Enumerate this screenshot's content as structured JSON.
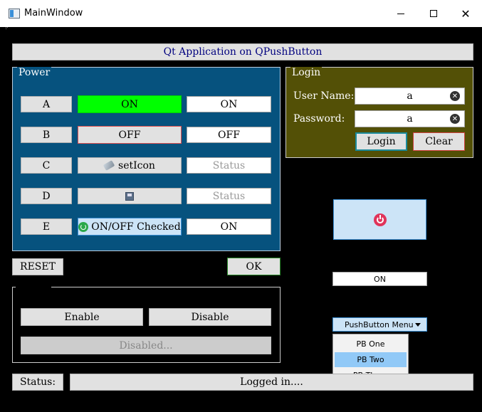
{
  "window": {
    "title": "MainWindow"
  },
  "header": {
    "title": "Qt Application on QPushButton"
  },
  "power": {
    "title": "Power",
    "rows": [
      {
        "letter": "A",
        "middle": "ON",
        "right": "ON"
      },
      {
        "letter": "B",
        "middle": "OFF",
        "right": "OFF"
      },
      {
        "letter": "C",
        "middle": "setIcon",
        "right": "Status"
      },
      {
        "letter": "D",
        "middle": "",
        "right": "Status"
      },
      {
        "letter": "E",
        "middle": "ON/OFF Checked",
        "right": "ON"
      }
    ],
    "reset_label": "RESET",
    "ok_label": "OK"
  },
  "login": {
    "title": "Login",
    "username_label": "User Name:",
    "username_value": "a",
    "password_label": "Password:",
    "password_value": "a",
    "login_label": "Login",
    "clear_label": "Clear"
  },
  "bottom": {
    "enable_label": "Enable",
    "disable_label": "Disable",
    "disabled_label": "Disabled..."
  },
  "right": {
    "on_label": "ON",
    "menu_button_label": "PushButton Menu",
    "menu_items": [
      "PB One",
      "PB Two",
      "PB Three"
    ],
    "highlighted_item": "PB Two"
  },
  "status": {
    "label": "Status:",
    "text": "Logged in...."
  },
  "colors": {
    "power_bg": "#06527e",
    "login_bg": "#535006",
    "on_green": "#00ff00",
    "off_border": "#e05050",
    "login_border": "#1a8a9a",
    "clear_border": "#d04040",
    "power_icon": "#e0345a"
  }
}
